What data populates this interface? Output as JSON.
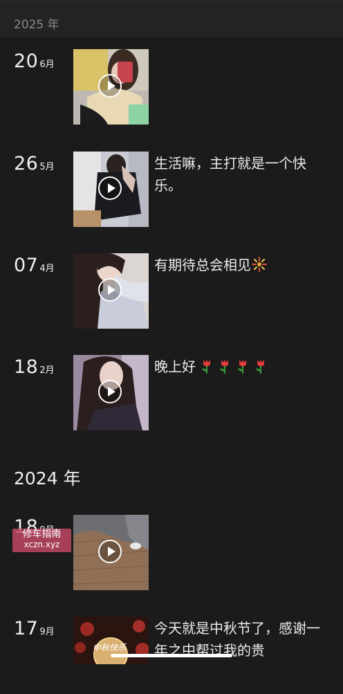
{
  "header": {
    "year_label": "2025 年"
  },
  "posts_2025": [
    {
      "day": "20",
      "month": "6月",
      "caption": ""
    },
    {
      "day": "26",
      "month": "5月",
      "caption": "生活嘛，主打就是一个快乐。"
    },
    {
      "day": "07",
      "month": "4月",
      "caption": "有期待总会相见",
      "emoji": "fireworks-icon"
    },
    {
      "day": "18",
      "month": "2月",
      "caption": "晚上好",
      "emoji": "tulip-icon x4"
    }
  ],
  "year_2024": {
    "label": "2024 年"
  },
  "posts_2024": [
    {
      "day": "18",
      "month": "9月",
      "caption": ""
    },
    {
      "day": "17",
      "month": "9月",
      "caption": "今天就是中秋节了，感谢一年之中帮过我的贵",
      "thumb_text": "中秋快乐"
    }
  ],
  "watermark": {
    "line1": "修车指南",
    "line2": "xczn.xyz"
  },
  "colors": {
    "background": "#1b1b1b",
    "header": "#232323",
    "text": "#ececec"
  }
}
